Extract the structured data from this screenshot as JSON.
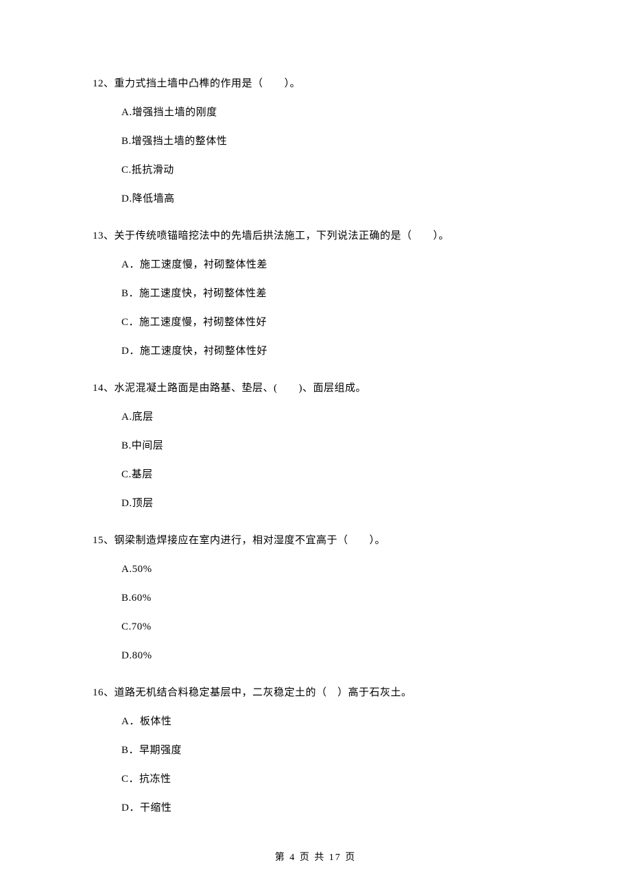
{
  "questions": [
    {
      "num": "12、",
      "stem": "重力式挡土墙中凸榫的作用是（　　）。",
      "options": {
        "A": "A.增强挡土墙的刚度",
        "B": "B.增强挡土墙的整体性",
        "C": "C.抵抗滑动",
        "D": "D.降低墙高"
      }
    },
    {
      "num": "13、",
      "stem": "关于传统喷锚暗挖法中的先墙后拱法施工，下列说法正确的是（　　）。",
      "options": {
        "A": "A．施工速度慢，衬砌整体性差",
        "B": "B．施工速度快，衬砌整体性差",
        "C": "C．施工速度慢，衬砌整体性好",
        "D": "D．施工速度快，衬砌整体性好"
      }
    },
    {
      "num": "14、",
      "stem": "水泥混凝土路面是由路基、垫层、(　　)、面层组成。",
      "options": {
        "A": "A.底层",
        "B": "B.中间层",
        "C": "C.基层",
        "D": "D.顶层"
      }
    },
    {
      "num": "15、",
      "stem": "钢梁制造焊接应在室内进行，相对湿度不宜高于（　　）。",
      "options": {
        "A": "A.50%",
        "B": "B.60%",
        "C": "C.70%",
        "D": "D.80%"
      }
    },
    {
      "num": "16、",
      "stem": "道路无机结合料稳定基层中，二灰稳定土的（　）高于石灰土。",
      "options": {
        "A": "A．板体性",
        "B": "B．早期强度",
        "C": "C．抗冻性",
        "D": "D．干缩性"
      }
    }
  ],
  "footer": "第 4 页 共 17 页"
}
